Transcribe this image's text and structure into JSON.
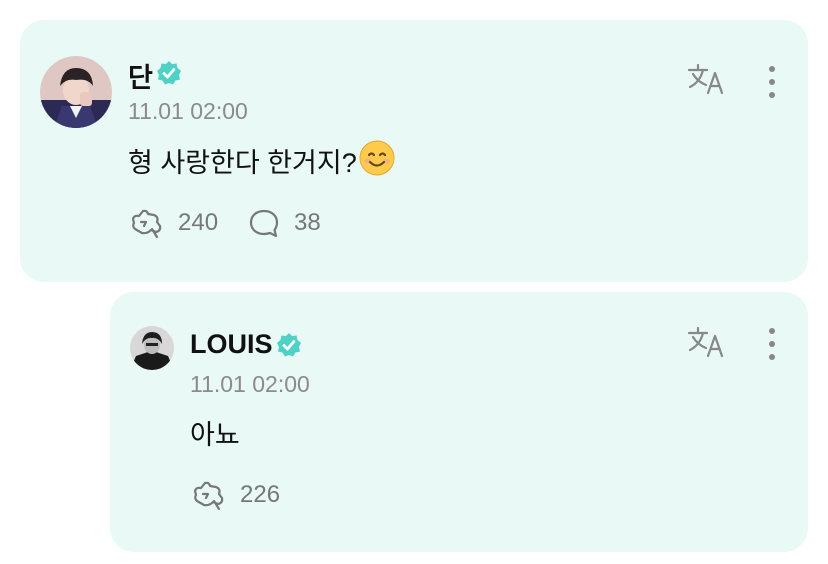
{
  "colors": {
    "card_bg": "#e8f9f6",
    "verified": "#4fd1c5",
    "muted": "#8b8b8b",
    "text": "#111111"
  },
  "post": {
    "author": "단",
    "verified": true,
    "timestamp": "11.01 02:00",
    "text": "형 사랑한다 한거지?",
    "emoji": "smiling-face-emoji",
    "likes": "240",
    "comments": "38",
    "translate_icon": "translate-icon",
    "more_icon": "more-vertical-icon"
  },
  "reply": {
    "author": "LOUIS",
    "verified": true,
    "timestamp": "11.01 02:00",
    "text": "아뇨",
    "likes": "226",
    "translate_icon": "translate-icon",
    "more_icon": "more-vertical-icon"
  }
}
